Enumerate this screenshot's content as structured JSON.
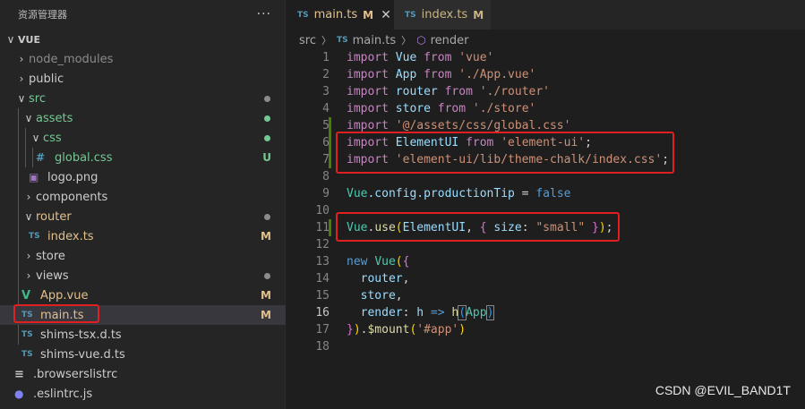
{
  "sidebar": {
    "title": "资源管理器",
    "more": "···",
    "tree": [
      {
        "label": "VUE",
        "chev": "∨",
        "badge": ""
      },
      {
        "label": "node_modules",
        "chev": "›",
        "badge": ""
      },
      {
        "label": "public",
        "chev": "›",
        "badge": ""
      },
      {
        "label": "src",
        "chev": "∨",
        "badge": ""
      },
      {
        "label": "assets",
        "chev": "∨",
        "badge": ""
      },
      {
        "label": "css",
        "chev": "∨",
        "badge": ""
      },
      {
        "label": "global.css",
        "icon": "#",
        "badge": "U"
      },
      {
        "label": "logo.png",
        "icon": "▣",
        "badge": ""
      },
      {
        "label": "components",
        "chev": "›",
        "badge": ""
      },
      {
        "label": "router",
        "chev": "∨",
        "badge": ""
      },
      {
        "label": "index.ts",
        "icon": "TS",
        "badge": "M"
      },
      {
        "label": "store",
        "chev": "›",
        "badge": ""
      },
      {
        "label": "views",
        "chev": "›",
        "badge": ""
      },
      {
        "label": "App.vue",
        "icon": "V",
        "badge": "M"
      },
      {
        "label": "main.ts",
        "icon": "TS",
        "badge": "M"
      },
      {
        "label": "shims-tsx.d.ts",
        "icon": "TS",
        "badge": ""
      },
      {
        "label": "shims-vue.d.ts",
        "icon": "TS",
        "badge": ""
      },
      {
        "label": ".browserslistrc",
        "icon": "≡",
        "badge": ""
      },
      {
        "label": ".eslintrc.js",
        "icon": "●",
        "badge": ""
      }
    ]
  },
  "tabs": [
    {
      "icon": "TS",
      "name": "main.ts",
      "mod": "M",
      "close": "✕"
    },
    {
      "icon": "TS",
      "name": "index.ts",
      "mod": "M"
    }
  ],
  "breadcrumb": {
    "folder": "src",
    "ts": "TS",
    "file": "main.ts",
    "symbol": "render",
    "sep": "〉",
    "cube_icon": "⬡"
  },
  "code": {
    "l1": {
      "kw": "import",
      "id": "Vue",
      "from": "from",
      "str": "'vue'"
    },
    "l2": {
      "kw": "import",
      "id": "App",
      "from": "from",
      "str": "'./App.vue'"
    },
    "l3": {
      "kw": "import",
      "id": "router",
      "from": "from",
      "str": "'./router'"
    },
    "l4": {
      "kw": "import",
      "id": "store",
      "from": "from",
      "str": "'./store'"
    },
    "l5": {
      "kw": "import",
      "str": "'@/assets/css/global.css'"
    },
    "l6": {
      "kw": "import",
      "id": "ElementUI",
      "from": "from",
      "str": "'element-ui'",
      "end": ";"
    },
    "l7": {
      "kw": "import",
      "str": "'element-ui/lib/theme-chalk/index.css'",
      "end": ";"
    },
    "l9": {
      "obj": "Vue",
      "p1": ".config.",
      "prop": "productionTip",
      "eq": " = ",
      "val": "false"
    },
    "l11": {
      "obj": "Vue",
      "dot": ".",
      "fn": "use",
      "open": "(",
      "arg": "ElementUI",
      "comma": ", ",
      "bopen": "{",
      "key": " size",
      "colon": ": ",
      "val": "\"small\"",
      "bclose": " }",
      "close": ")",
      "end": ";"
    },
    "l13": {
      "kw": "new",
      "cls": "Vue",
      "open": "(",
      "bopen": "{"
    },
    "l14": {
      "text": "router",
      "end": ","
    },
    "l15": {
      "text": "store",
      "end": ","
    },
    "l16": {
      "key": "render",
      "colon": ": ",
      "h": "h",
      "arrow": " => ",
      "fn": "h",
      "open": "(",
      "arg": "App",
      "close": ")"
    },
    "l17": {
      "bclose": "}",
      "close": ")",
      "dot": ".",
      "fn": "$mount",
      "open": "(",
      "str": "'#app'",
      "pclose": ")"
    }
  },
  "line_numbers": [
    "1",
    "2",
    "3",
    "4",
    "5",
    "6",
    "7",
    "8",
    "9",
    "10",
    "11",
    "12",
    "13",
    "14",
    "15",
    "16",
    "17",
    "18"
  ],
  "watermark": "CSDN @EVIL_BAND1T",
  "colors": {
    "highlight_box": "#e02020",
    "git_added": "#487e02",
    "badge_modified": "#e2c08d",
    "badge_untracked": "#73c991"
  }
}
